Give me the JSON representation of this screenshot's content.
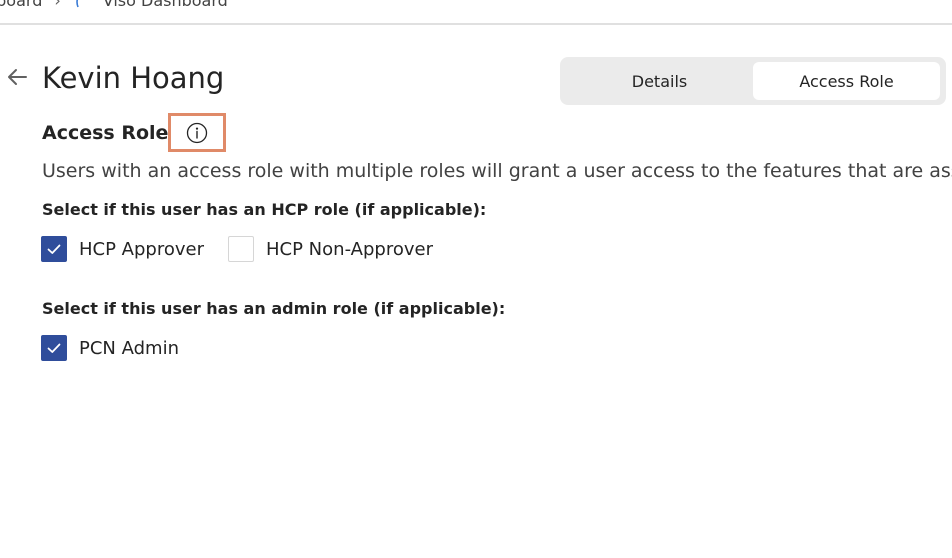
{
  "breadcrumb": {
    "first": "nboard",
    "separator": "›",
    "second": "Viso Dashboard"
  },
  "page": {
    "title": "Kevin Hoang"
  },
  "tabs": [
    {
      "label": "Details",
      "selected": false
    },
    {
      "label": "Access Role",
      "selected": true
    }
  ],
  "section": {
    "title": "Access Role",
    "description": "Users with an access role with multiple roles will grant a user access to the features that are asso"
  },
  "hcp_group": {
    "label": "Select if this user has an HCP role (if applicable):",
    "options": [
      {
        "label": "HCP Approver",
        "checked": true
      },
      {
        "label": "HCP Non-Approver",
        "checked": false
      }
    ]
  },
  "admin_group": {
    "label": "Select if this user has an admin role (if applicable):",
    "options": [
      {
        "label": "PCN Admin",
        "checked": true
      }
    ]
  },
  "colors": {
    "accent": "#2f4d9b",
    "highlight": "#e08a68",
    "tab_track": "#ebebeb"
  },
  "icons": {
    "back": "arrow-left-icon",
    "info": "info-circle-icon",
    "check": "checkmark-icon",
    "app": "viso-logo-icon"
  }
}
